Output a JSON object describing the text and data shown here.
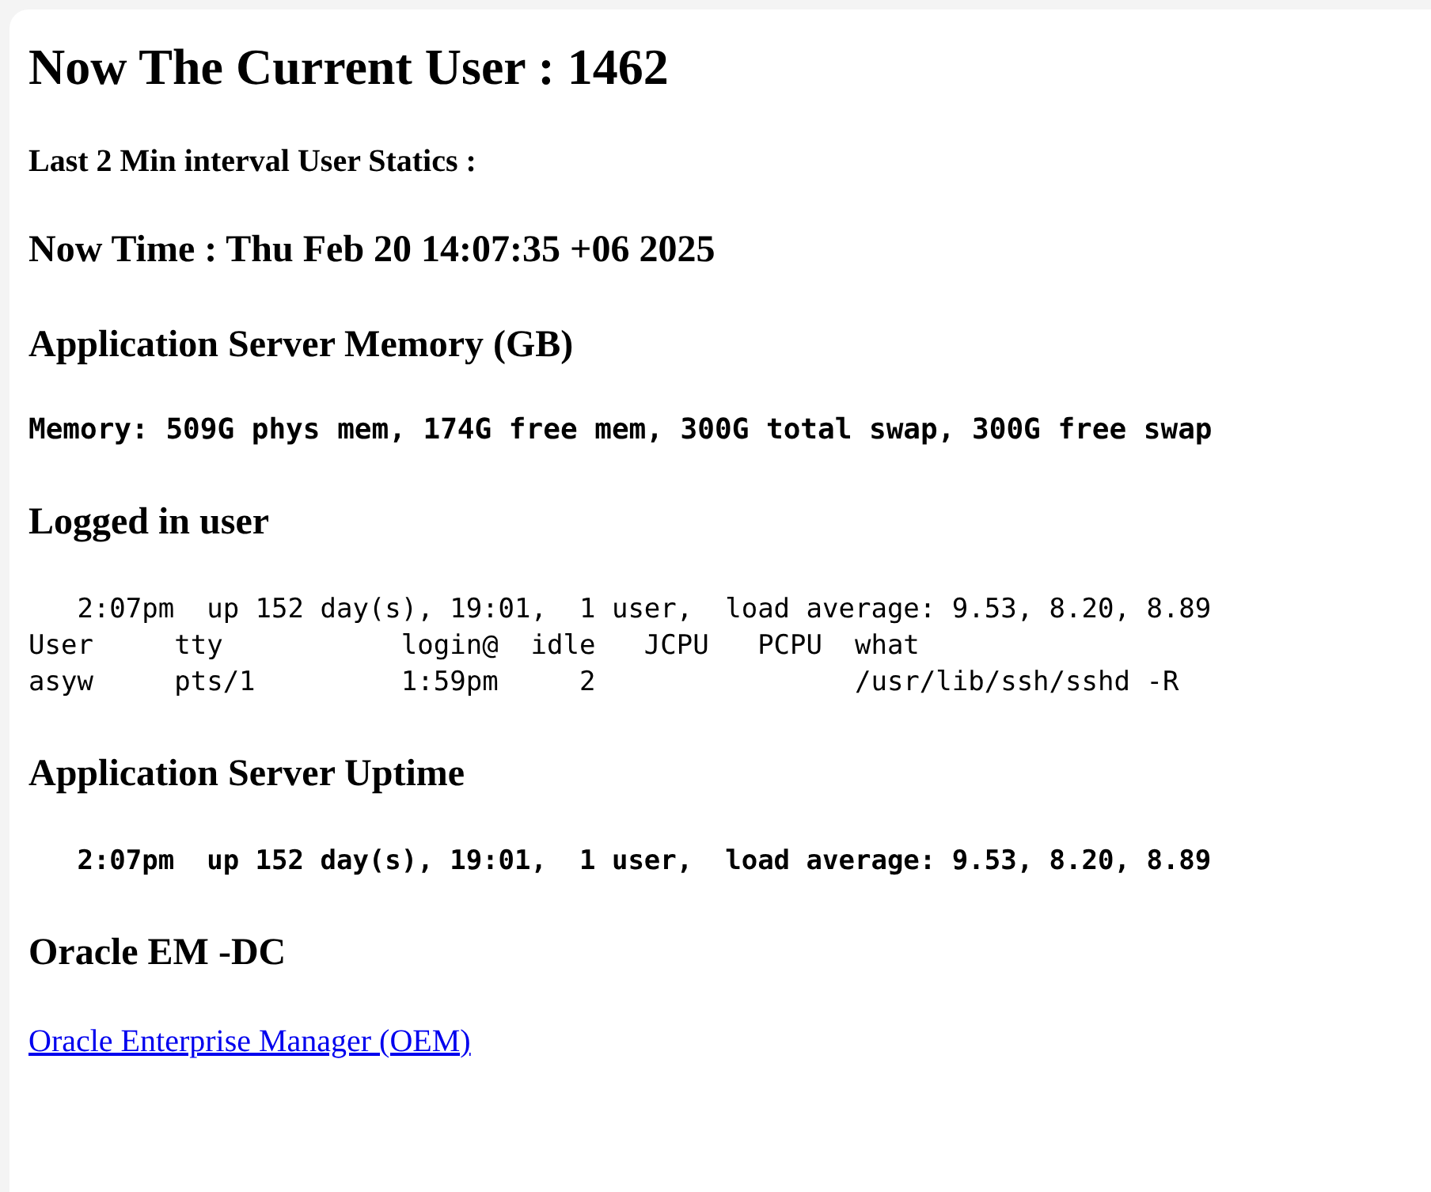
{
  "current_user_heading": "Now The Current User : 1462",
  "interval_heading": "Last 2 Min interval User Statics :",
  "time_heading": "Now Time : Thu Feb 20 14:07:35 +06 2025",
  "sections": [
    {
      "kind": "memory",
      "title": "Application Server Memory (GB)",
      "lines": [
        "Memory: 509G phys mem, 174G free mem, 300G total swap, 300G free swap"
      ]
    },
    {
      "kind": "output",
      "title": "Logged in user",
      "lines": [
        "   2:07pm  up 152 day(s), 19:01,  1 user,  load average: 9.53, 8.20, 8.89",
        "User     tty           login@  idle   JCPU   PCPU  what",
        "asyw     pts/1         1:59pm     2                /usr/lib/ssh/sshd -R"
      ]
    },
    {
      "kind": "uptime",
      "title": "Application Server Uptime",
      "lines": [
        "   2:07pm  up 152 day(s), 19:01,  1 user,  load average: 9.53, 8.20, 8.89"
      ]
    },
    {
      "kind": "link",
      "title": "Oracle EM -DC",
      "lines": [
        "Oracle Enterprise Manager (OEM)"
      ]
    }
  ]
}
